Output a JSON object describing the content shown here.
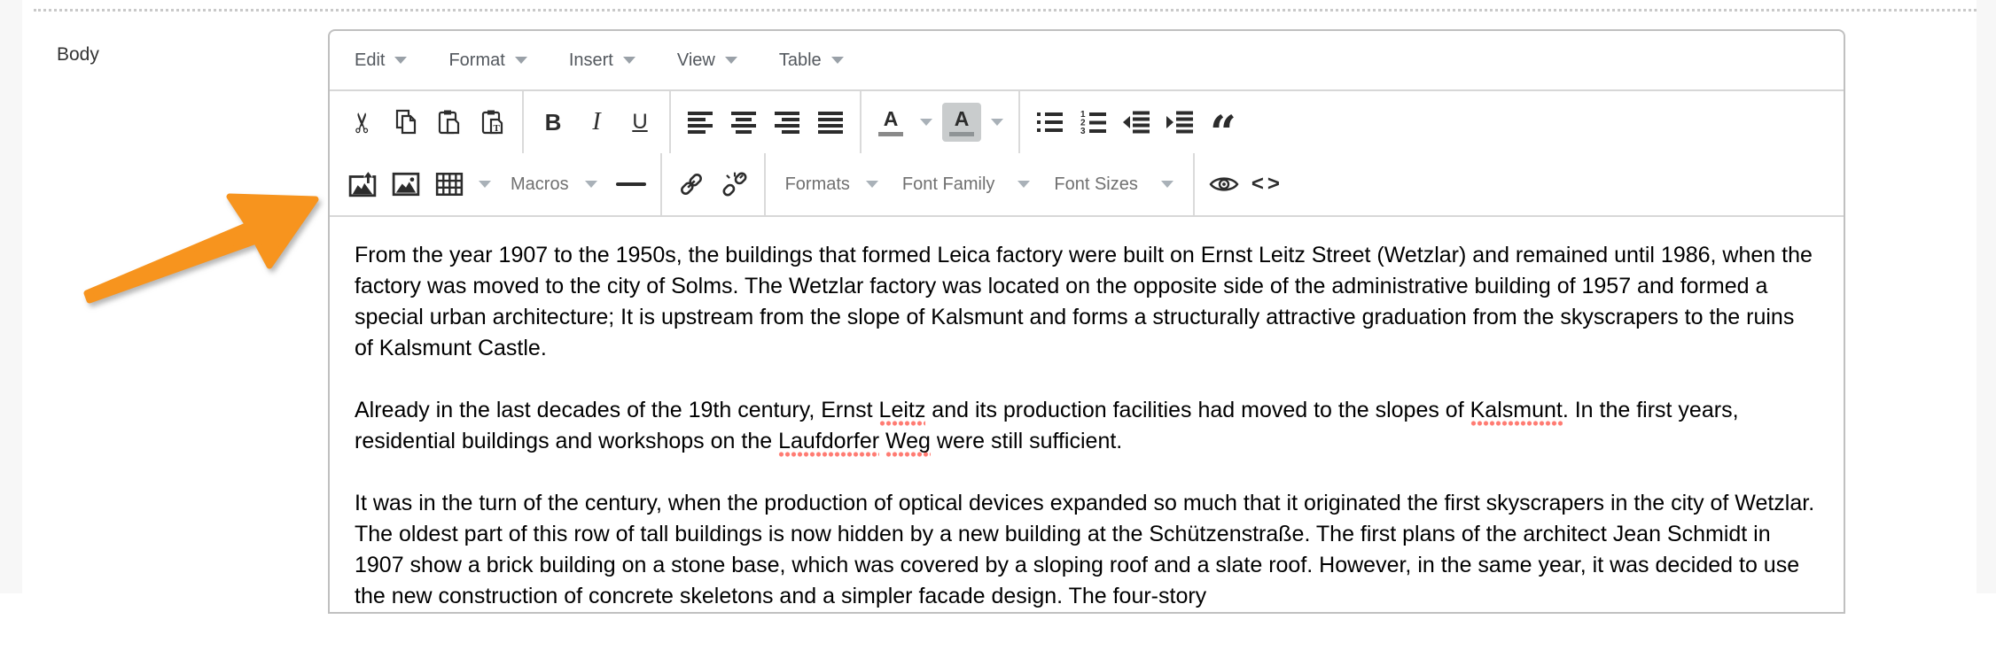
{
  "field_label": "Body",
  "menubar": {
    "items": [
      "Edit",
      "Format",
      "Insert",
      "View",
      "Table"
    ]
  },
  "toolbar": {
    "row1": {
      "icons": [
        "cut-icon",
        "copy-icon",
        "paste-icon",
        "paste-as-text-icon",
        "align-left-icon",
        "align-center-icon",
        "align-right-icon",
        "justify-icon",
        "text-color-swatch",
        "background-color-swatch",
        "bullet-list-icon",
        "numbered-list-icon",
        "outdent-icon",
        "indent-icon",
        "blockquote-icon",
        "chevron-down-icon"
      ],
      "bold_label": "B",
      "italic_label": "I",
      "underline_label": "U",
      "forecolor_label": "A",
      "backcolor_label": "A",
      "blockquote_label": "“"
    },
    "row2": {
      "icons": [
        "insert-image-icon",
        "image-icon",
        "table-icon",
        "horizontal-rule-icon",
        "link-icon",
        "unlink-icon",
        "preview-eye-icon",
        "source-code-icon",
        "chevron-down-icon"
      ],
      "macros_label": "Macros",
      "formats_label": "Formats",
      "font_family_label": "Font Family",
      "font_sizes_label": "Font Sizes",
      "code_label": "<>"
    }
  },
  "editor": {
    "paragraphs": [
      {
        "segments": [
          {
            "text": "From the year 1907 to the 1950s, the buildings that formed Leica factory were built on Ernst Leitz Street (Wetzlar) and remained until 1986, when the factory was moved to the city of Solms. The Wetzlar factory was located on the opposite side of the administrative building of 1957 and formed a special urban architecture; It is upstream from the slope of Kalsmunt and forms a structurally attractive graduation from the skyscrapers to the ruins of Kalsmunt Castle."
          }
        ]
      },
      {
        "segments": [
          {
            "text": "Already in the last decades of the 19th century, Ernst "
          },
          {
            "text": "Leitz",
            "misspelled": true
          },
          {
            "text": " and its production facilities had moved to the slopes of "
          },
          {
            "text": "Kalsmunt",
            "misspelled": true
          },
          {
            "text": ". In the first years, residential buildings and workshops on the "
          },
          {
            "text": "Laufdorfer",
            "misspelled": true
          },
          {
            "text": " "
          },
          {
            "text": "Weg",
            "misspelled": true
          },
          {
            "text": " were still sufficient."
          }
        ]
      },
      {
        "segments": [
          {
            "text": "It was in the turn of the century, when the production of optical devices expanded so much that it originated the first skyscrapers in the city of Wetzlar. The oldest part of this row of tall buildings is now hidden by a new building at the Schützenstraße. The first plans of the architect Jean Schmidt in 1907 show a brick building on a stone base, which was covered by a sloping roof and a slate roof. However, in the same year, it was decided to use the new construction of concrete skeletons and a simpler facade design. The four-story"
          }
        ]
      }
    ]
  },
  "annotation": {
    "arrow_color": "#F7941E"
  },
  "colors": {
    "spellcheck_underline": "#FF7B72",
    "toolbar_icon": "#2C2C2C",
    "editor_border": "#C0C0C0",
    "divider": "#D7D7D7",
    "rail_background": "#F7F7F7",
    "menu_text": "#53585E",
    "listbox_text": "#707070",
    "backcolor_button_bg": "#C9CCCD",
    "color_swatch_bar": "#8A8A8A"
  }
}
